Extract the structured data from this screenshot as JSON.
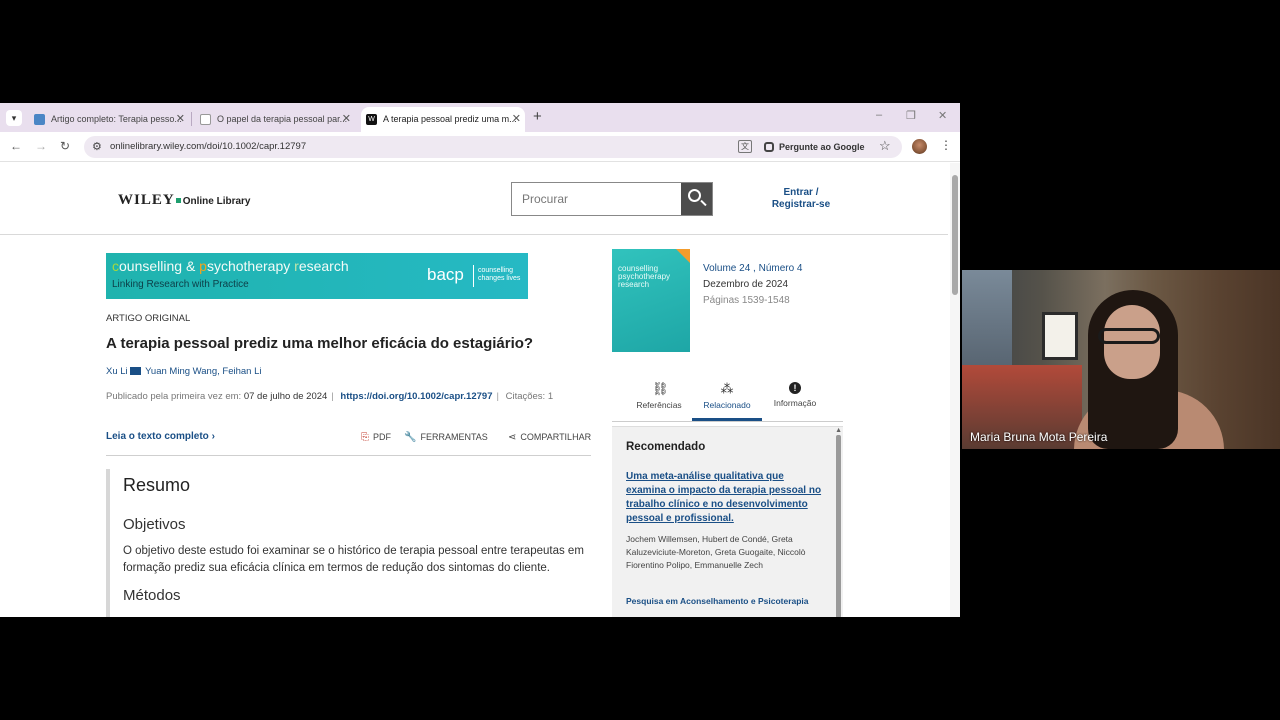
{
  "browser": {
    "tabs": [
      {
        "title": "Artigo completo: Terapia pesso..."
      },
      {
        "title": "O papel da terapia pessoal par..."
      },
      {
        "title": "A terapia pessoal prediz uma m..."
      }
    ],
    "url": "onlinelibrary.wiley.com/doi/10.1002/capr.12797",
    "ask_google": "Pergunte ao Google"
  },
  "site": {
    "logo": "WILEY",
    "logo_sub": "Online Library",
    "search_placeholder": "Procurar",
    "login": "Entrar / Registrar-se"
  },
  "journal_banner": {
    "c": "c",
    "ounselling": "ounselling &amp; ",
    "title_parts": [
      "c",
      "ounselling & ",
      "p",
      "sychotherapy ",
      "r",
      "esearch"
    ],
    "subtitle": "Linking Research with Practice",
    "org": "bacp",
    "tagline": [
      "counselling",
      "changes lives"
    ]
  },
  "article": {
    "type": "ARTIGO ORIGINAL",
    "title": "A terapia pessoal prediz uma melhor eficácia do estagiário?",
    "authors": [
      "Xu Li",
      "Yuan Ming Wang",
      "Feihan Li"
    ],
    "published_label": "Publicado pela primeira vez em:",
    "published_date": "07 de julho de 2024",
    "doi": "https://doi.org/10.1002/capr.12797",
    "citations": "Citações: 1",
    "read_full": "Leia o texto completo",
    "pdf": "PDF",
    "tools": "FERRAMENTAS",
    "share": "COMPARTILHAR"
  },
  "abstract": {
    "heading": "Resumo",
    "objectives_heading": "Objetivos",
    "objectives_text": "O objetivo deste estudo foi examinar se o histórico de terapia pessoal entre terapeutas em formação prediz sua eficácia clínica em termos de redução dos sintomas do cliente.",
    "methods_heading": "Métodos"
  },
  "issue": {
    "cover_title": "counselling psychotherapy research",
    "volume": "Volume  24 , Número  4",
    "date": "Dezembro de 2024",
    "pages": "Páginas 1539-1548"
  },
  "right_tabs": [
    {
      "label": "Referências",
      "icon": "link-icon"
    },
    {
      "label": "Relacionado",
      "icon": "related-icon"
    },
    {
      "label": "Informação",
      "icon": "info-icon"
    }
  ],
  "recommended": {
    "heading": "Recomendado",
    "link": "Uma meta-análise qualitativa que examina o impacto da terapia pessoal no trabalho clínico e no desenvolvimento pessoal e profissional.",
    "authors": "Jochem Willemsen, Hubert de Condé, Greta Kaluzeviciute-Moreton, Greta Guogaite, Niccolò Fiorentino Polipo, Emmanuelle Zech",
    "journal": "Pesquisa em Aconselhamento e Psicoterapia"
  },
  "video": {
    "participant": "Maria Bruna Mota Pereira"
  }
}
